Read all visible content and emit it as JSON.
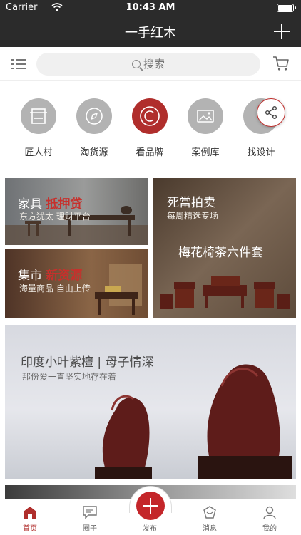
{
  "status_bar": {
    "carrier": "Carrier",
    "time": "10:43 AM"
  },
  "nav": {
    "title": "一手红木"
  },
  "search": {
    "placeholder": "搜索"
  },
  "categories": [
    {
      "label": "匠人村",
      "icon": "craftsman-icon"
    },
    {
      "label": "淘货源",
      "icon": "compass-icon"
    },
    {
      "label": "看品牌",
      "icon": "copyright-icon"
    },
    {
      "label": "案例库",
      "icon": "gallery-icon"
    },
    {
      "label": "找设计",
      "icon": "design-icon"
    }
  ],
  "banners": {
    "furniture": {
      "title": "家具",
      "highlight": "抵押贷",
      "subtitle": "东方犹太 理财平台"
    },
    "auction": {
      "title": "死當拍卖",
      "subtitle": "每周精选专场",
      "product": "梅花椅茶六件套"
    },
    "market": {
      "title": "集市",
      "highlight": "新资源",
      "subtitle": "海量商品 自由上传"
    },
    "feature": {
      "title": "印度小叶紫檀 | 母子情深",
      "subtitle": "那份爱一直坚实地存在着"
    }
  },
  "tab_bar": [
    {
      "label": "首页",
      "icon": "home-icon",
      "active": true
    },
    {
      "label": "圈子",
      "icon": "chat-icon",
      "active": false
    },
    {
      "label": "发布",
      "icon": "publish-icon",
      "active": false
    },
    {
      "label": "消息",
      "icon": "message-icon",
      "active": false
    },
    {
      "label": "我的",
      "icon": "profile-icon",
      "active": false
    }
  ],
  "colors": {
    "bar": "#2b2b2b",
    "accent": "#c4262a",
    "icon_gray": "#b3b3b3"
  }
}
